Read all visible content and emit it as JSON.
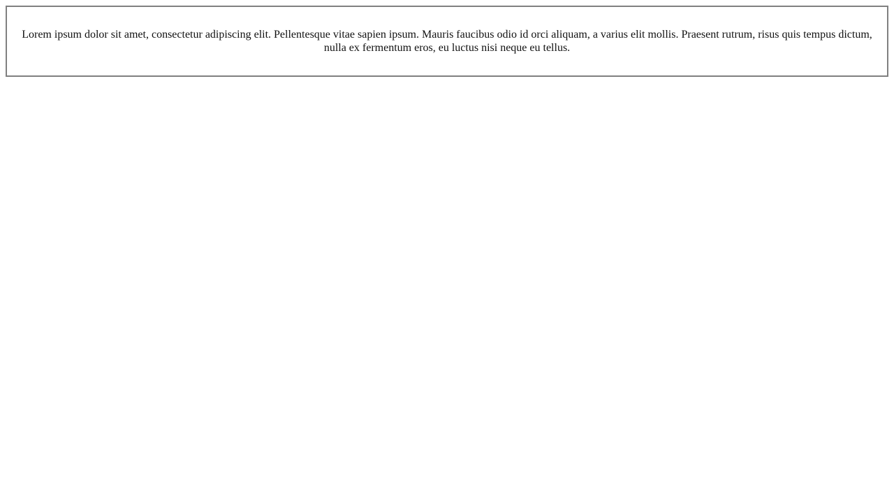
{
  "content": {
    "paragraph": "Lorem ipsum dolor sit amet, consectetur adipiscing elit. Pellentesque vitae sapien ipsum. Mauris faucibus odio id orci aliquam, a varius elit mollis. Praesent rutrum, risus quis tempus dictum, nulla ex fermentum eros, eu luctus nisi neque eu tellus."
  }
}
